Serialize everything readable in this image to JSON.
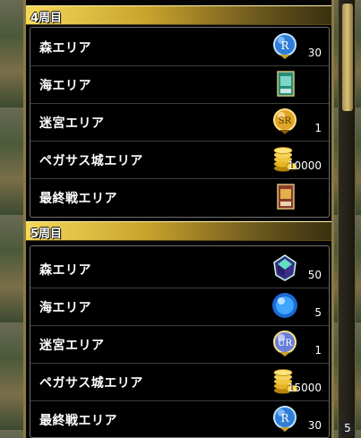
{
  "sections": [
    {
      "title": "4周目",
      "rows": [
        {
          "area": "森エリア",
          "icon": "r-ticket-orb-icon",
          "qty": "30"
        },
        {
          "area": "海エリア",
          "icon": "card-icon",
          "qty": ""
        },
        {
          "area": "迷宮エリア",
          "icon": "sr-ticket-orb-icon",
          "qty": "1"
        },
        {
          "area": "ペガサス城エリア",
          "icon": "gold-coins-icon",
          "qty": "10000"
        },
        {
          "area": "最終戦エリア",
          "icon": "card-icon",
          "qty": ""
        }
      ]
    },
    {
      "title": "5周目",
      "rows": [
        {
          "area": "森エリア",
          "icon": "crystal-gem-icon",
          "qty": "50"
        },
        {
          "area": "海エリア",
          "icon": "blue-orb-icon",
          "qty": "5"
        },
        {
          "area": "迷宮エリア",
          "icon": "ur-ticket-orb-icon",
          "qty": "1"
        },
        {
          "area": "ペガサス城エリア",
          "icon": "gold-coins-icon",
          "qty": "15000"
        },
        {
          "area": "最終戦エリア",
          "icon": "r-ticket-orb-icon",
          "qty": "30"
        }
      ]
    }
  ],
  "scrollbar": {
    "page_number": "5"
  },
  "colors": {
    "header_gold": "#f4d95a",
    "panel_bg": "#050505",
    "frame": "#8d7a3f"
  }
}
